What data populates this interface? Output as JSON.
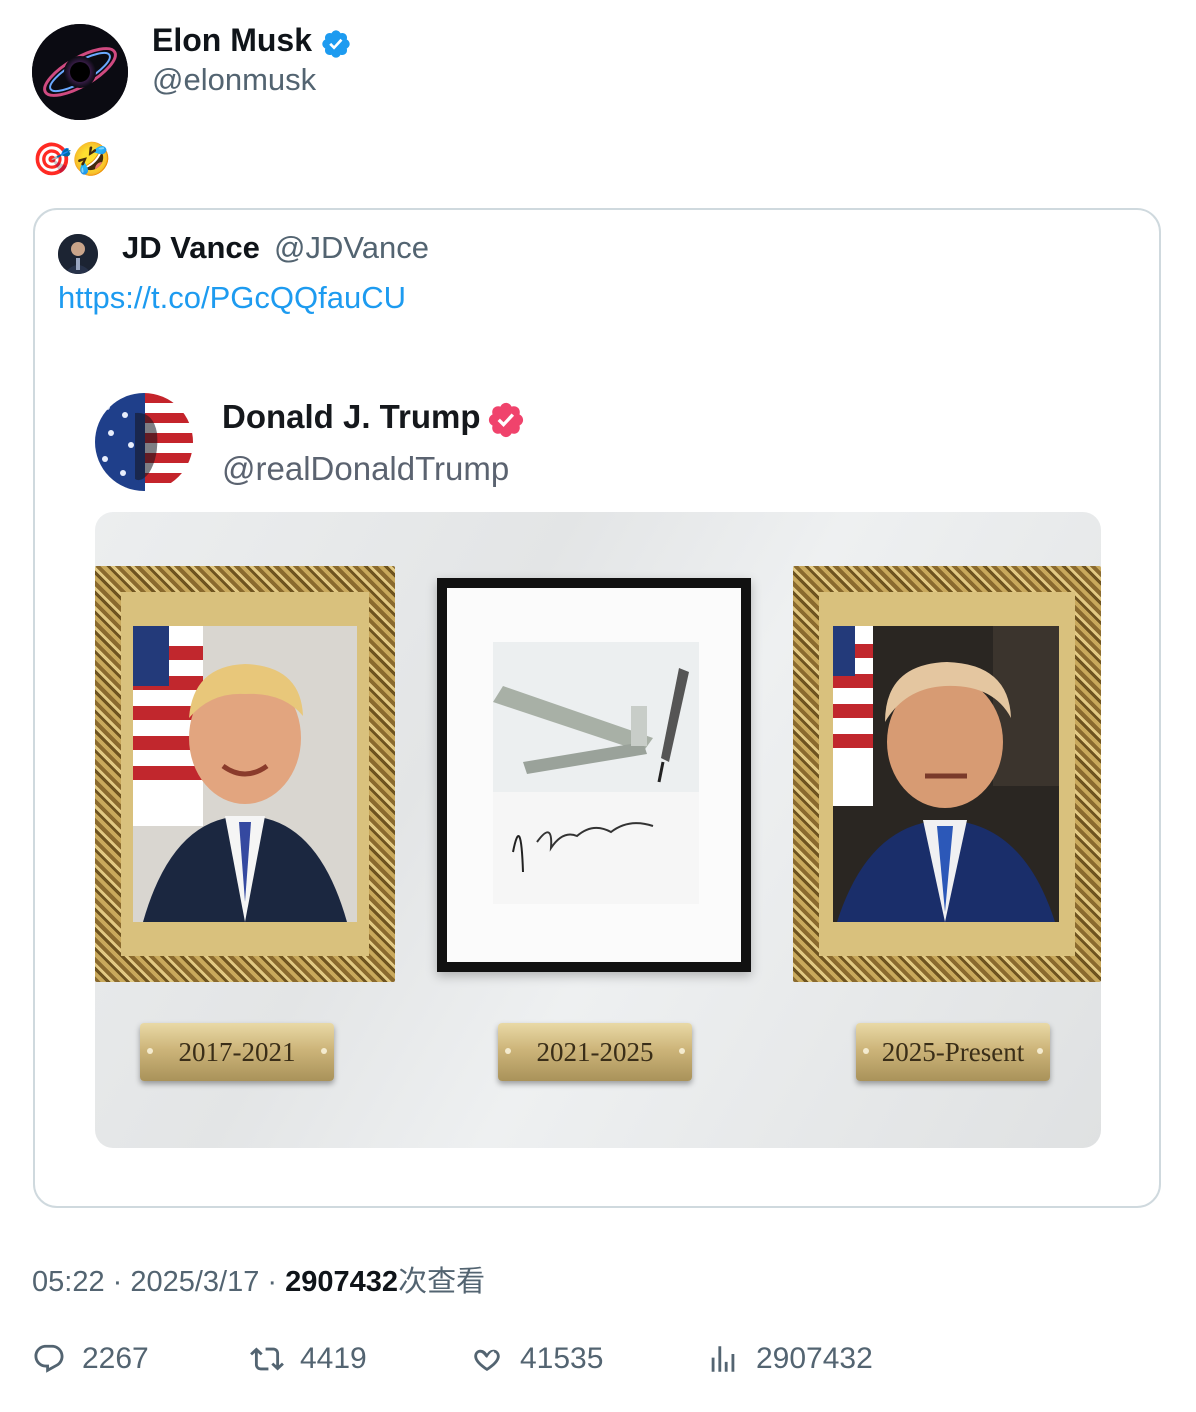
{
  "author": {
    "name": "Elon Musk",
    "handle": "@elonmusk",
    "verified_color": "#1d9bf0"
  },
  "tweet": {
    "text": "🎯🤣"
  },
  "quoted": {
    "name": "JD Vance",
    "handle": "@JDVance",
    "link": "https://t.co/PGcQQfauCU"
  },
  "embedded_post": {
    "name": "Donald J. Trump",
    "handle": "@realDonaldTrump",
    "verified_color": "#f0436c",
    "plaques": [
      "2017-2021",
      "2021-2025",
      "2025-Present"
    ]
  },
  "meta": {
    "time": "05:22",
    "date": "2025/3/17",
    "views": "2907432",
    "views_suffix": "次查看"
  },
  "actions": {
    "replies": "2267",
    "reposts": "4419",
    "likes": "41535",
    "views": "2907432"
  },
  "icons": [
    "verified-badge-icon",
    "reply-icon",
    "repost-icon",
    "like-icon",
    "views-icon"
  ]
}
